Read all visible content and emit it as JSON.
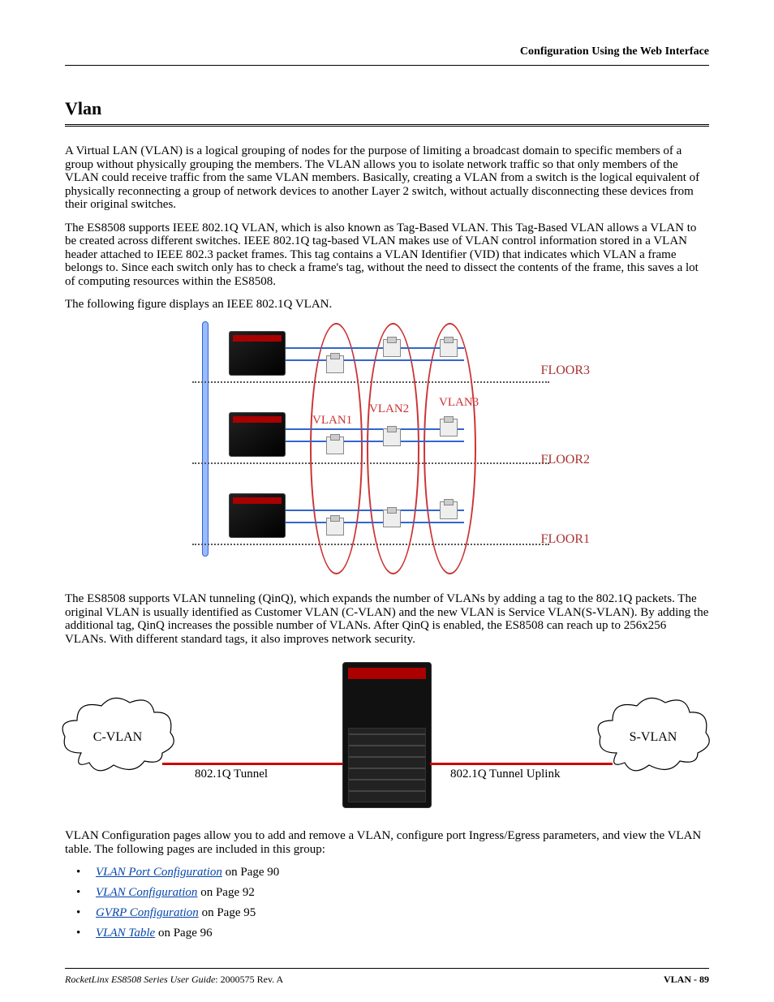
{
  "header": {
    "right": "Configuration Using the Web Interface"
  },
  "section": {
    "title": "Vlan"
  },
  "paragraphs": {
    "p1": "A Virtual LAN (VLAN) is a logical grouping of nodes for the purpose of limiting a broadcast domain to specific members of a group without physically grouping the members. The VLAN allows you to isolate network traffic so that only members of the VLAN could receive traffic from the same VLAN members. Basically, creating a VLAN from a switch is the logical equivalent of physically reconnecting a group of network devices to another Layer 2 switch, without actually disconnecting these devices from their original switches.",
    "p2": "The ES8508 supports IEEE 802.1Q VLAN, which is also known as Tag-Based VLAN. This Tag-Based VLAN allows a VLAN to be created across different switches. IEEE 802.1Q tag-based VLAN makes use of VLAN control information stored in a VLAN header attached to IEEE 802.3 packet frames. This tag contains a VLAN Identifier (VID) that indicates which VLAN a frame belongs to. Since each switch only has to check a frame's tag, without the need to dissect the contents of the frame, this saves a lot of computing resources within the ES8508.",
    "p3": "The following figure displays an IEEE 802.1Q VLAN.",
    "p4": "The ES8508 supports VLAN tunneling (QinQ), which expands the number of VLANs by adding a tag to the 802.1Q packets. The original VLAN is usually identified as Customer VLAN (C-VLAN) and the new VLAN is Service VLAN(S-VLAN). By adding the additional tag, QinQ increases the possible number of VLANs. After QinQ is enabled, the ES8508 can reach up to 256x256 VLANs. With different standard tags, it also improves network security.",
    "p5": "VLAN Configuration pages allow you to add and remove a VLAN, configure port Ingress/Egress parameters, and view the VLAN table. The following pages are included in this group:"
  },
  "figure1_labels": {
    "floor3": "FLOOR3",
    "floor2": "FLOOR2",
    "floor1": "FLOOR1",
    "vlan1": "VLAN1",
    "vlan2": "VLAN2",
    "vlan3": "VLAN3"
  },
  "figure2_labels": {
    "cvlan": "C-VLAN",
    "svlan": "S-VLAN",
    "tunnel": "802.1Q Tunnel",
    "uplink": "802.1Q Tunnel Uplink"
  },
  "links": [
    {
      "text": "VLAN Port Configuration",
      "suffix": " on Page 90"
    },
    {
      "text": "VLAN Configuration",
      "suffix": " on Page 92"
    },
    {
      "text": "GVRP Configuration",
      "suffix": " on Page 95"
    },
    {
      "text": "VLAN Table",
      "suffix": " on Page 96"
    }
  ],
  "footer": {
    "left_italic": "RocketLinx ES8508 Series  User Guide",
    "left_normal": ": 2000575 Rev. A",
    "right": "VLAN - 89"
  }
}
